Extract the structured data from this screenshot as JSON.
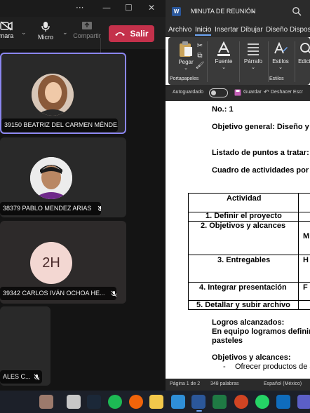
{
  "teams": {
    "titlebar": {
      "more": "···",
      "minimize": "—",
      "maximize": "☐",
      "close": "✕"
    },
    "toolbar": {
      "camera_label": "Cámara",
      "camera_label_visible": "mara",
      "mic_label": "Micro",
      "share_label": "Compartir",
      "leave_label": "Salir"
    },
    "participants": [
      {
        "name": "39150 BEATRIZ DEL CARMEN MÉNDE...",
        "muted": false,
        "active": true
      },
      {
        "name": "38379 PABLO MENDEZ ARIAS",
        "muted": true,
        "active": false
      },
      {
        "name": "39342 CARLOS IVÁN OCHOA HE...",
        "initials": "2H",
        "muted": true,
        "active": false
      },
      {
        "name": "ALES C...",
        "muted": true,
        "active": false
      }
    ]
  },
  "word": {
    "doc_title": "MINUTA DE REUNIÓN",
    "logo": "W",
    "menu": [
      "Archivo",
      "Inicio",
      "Insertar",
      "Dibujar",
      "Diseño",
      "Disposi"
    ],
    "active_menu": "Inicio",
    "ribbon": {
      "paste": "Pegar",
      "clipboard_group": "Portapapeles",
      "font": "Fuente",
      "paragraph": "Párrafo",
      "styles": "Estilos",
      "styles_group": "Estilos",
      "editing": "Edició"
    },
    "qat": {
      "autosave": "Autoguardado",
      "save": "Guardar",
      "undo": "Deshacer Escr"
    },
    "document": {
      "number": "No.: 1",
      "objective": "Objetivo general:  Diseño y",
      "points": "Listado de puntos a tratar:",
      "activities": "Cuadro de actividades por",
      "table_header": "Actividad",
      "rows": [
        {
          "label": "1. Definir el proyecto",
          "right": ""
        },
        {
          "label": "2. Objetivos y alcances",
          "right": "M"
        },
        {
          "label": "3. Entregables",
          "right": "H"
        },
        {
          "label": "4. Integrar presentación",
          "right": "F"
        },
        {
          "label": "5. Detallar y subir archivo",
          "right": ""
        }
      ],
      "achieved_title": "Logros alcanzados:",
      "achieved_line1": "En equipo logramos definir",
      "achieved_line2": "pasteles",
      "scope_title": "Objetivos y alcances:",
      "bullet_dash": "-",
      "scope_item": "Ofrecer productos de a"
    },
    "status": {
      "page": "Página 1 de 2",
      "words": "348 palabras",
      "language": "Español (México)"
    }
  },
  "colors": {
    "leave_red": "#c4314b",
    "active_border": "#8b86f0",
    "word_blue": "#2b579a"
  }
}
